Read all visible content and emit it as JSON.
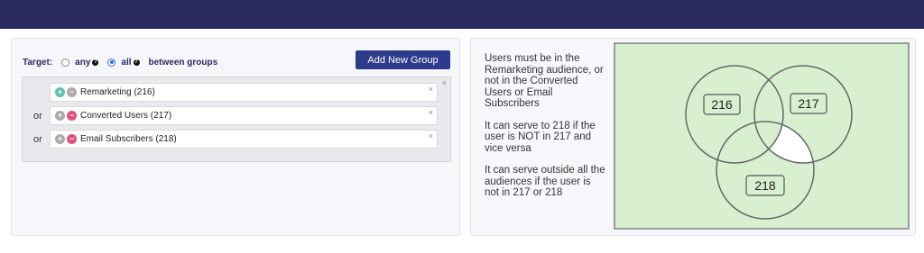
{
  "header": {
    "bg_color": "#2a2a5e"
  },
  "targeting": {
    "target_label": "Target:",
    "option_any": "any",
    "option_all": "all",
    "selected": "all",
    "between_groups": "between groups",
    "add_group_label": "Add New Group"
  },
  "group": {
    "rows": [
      {
        "connector": "",
        "name": "Remarketing (216)",
        "mode": "include"
      },
      {
        "connector": "or",
        "name": "Converted Users (217)",
        "mode": "exclude"
      },
      {
        "connector": "or",
        "name": "Email Subscribers (218)",
        "mode": "exclude"
      }
    ]
  },
  "explanation": {
    "p1": "Users must be in the Remarketing audience, or not in the Converted Users or Email Subscribers",
    "p2": "It can serve to 218 if the user is NOT in 217 and vice versa",
    "p3": "It can serve outside all the audiences if the user is not in 217 or 218"
  },
  "venn": {
    "labels": {
      "a": "216",
      "b": "217",
      "c": "218"
    },
    "colors": {
      "fill": "#d8f0d0",
      "stroke": "#666666",
      "hole": "#ffffff"
    }
  }
}
